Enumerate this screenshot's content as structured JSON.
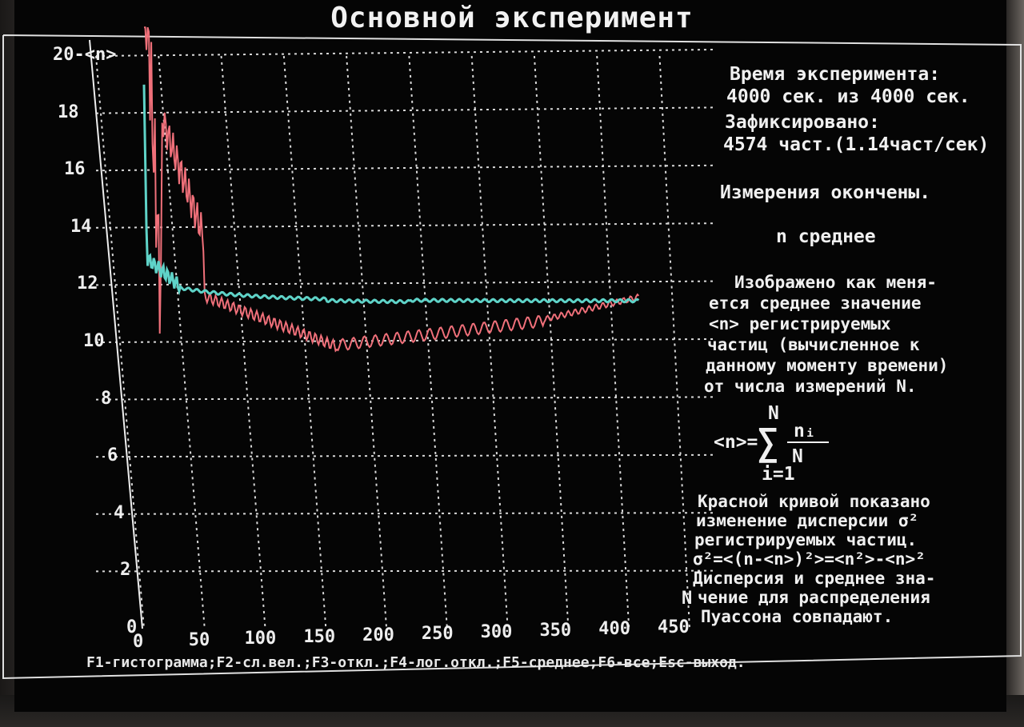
{
  "title": "Основной эксперимент",
  "axis": {
    "y_top_label": "20-<n>",
    "y_ticks": [
      "18",
      "16",
      "14",
      "12",
      "10",
      "8",
      "6",
      "4",
      "2",
      "0"
    ],
    "x_ticks": [
      "0",
      "50",
      "100",
      "150",
      "200",
      "250",
      "300",
      "350",
      "400",
      "450"
    ],
    "x_label": "N"
  },
  "info": {
    "time_label": "Время эксперимента:",
    "time_value": "4000 сек. из 4000 сек.",
    "fixed_label": "Зафиксировано:",
    "fixed_value": "4574 част.(1.14част/сек)",
    "status": "Измерения окончены.",
    "mode": "n среднее",
    "desc_lines": [
      "Изображено как меня-",
      "ется среднее значение",
      "<n> регистрируемых",
      "частиц (вычисленное к",
      "данному моменту времени)",
      "от числа измерений N."
    ],
    "formula": {
      "lhs": "<n>=",
      "sum": "∑",
      "upper": "N",
      "lower": "i=1",
      "numerator": "nᵢ",
      "denominator": "N"
    },
    "red_lines": [
      "Красной кривой показано",
      "изменение дисперсии σ²",
      "регистрируемых частиц.",
      "σ²=<(n-<n>)²>=<n²>-<n>²",
      "Дисперсия и среднее зна-",
      "чение для распределения",
      "Пуассона совпадают."
    ]
  },
  "footer": "F1-гистограмма;F2-сл.вел.;F3-откл.;F4-лог.откл.;F5-среднее;F6-все;Esc-выход.",
  "colors": {
    "mean": "#5fd3c8",
    "variance": "#f0707a"
  }
}
